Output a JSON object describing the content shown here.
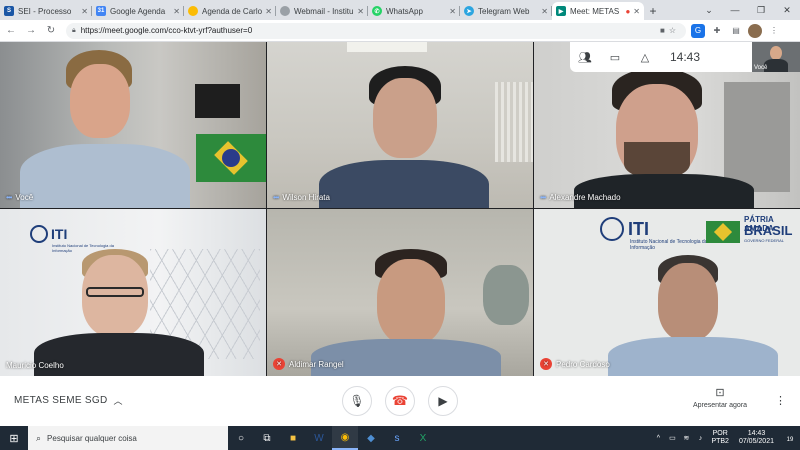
{
  "browser": {
    "tabs": [
      {
        "title": "SEI - Processo",
        "favicon": "SEI",
        "color": "#1a56a5",
        "active": false
      },
      {
        "title": "Google Agenda",
        "favicon": "31",
        "color": "#4285f4",
        "active": false
      },
      {
        "title": "Agenda de Carlo",
        "favicon": "●",
        "color": "#fbbc05",
        "active": false
      },
      {
        "title": "Webmail - Institu",
        "favicon": "●",
        "color": "#9aa0a6",
        "active": false
      },
      {
        "title": "WhatsApp",
        "favicon": "✆",
        "color": "#25d366",
        "active": false
      },
      {
        "title": "Telegram Web",
        "favicon": "➤",
        "color": "#2ca5e0",
        "active": false
      },
      {
        "title": "Meet: METAS",
        "favicon": "▶",
        "color": "#00897b",
        "active": true
      }
    ],
    "new_tab": "+",
    "url": "https://meet.google.com/cco-ktvt-yrf?authuser=0"
  },
  "meet": {
    "clock": "14:43",
    "self_label": "Você",
    "participants": [
      {
        "name": "Você",
        "muted": false,
        "speaking": true
      },
      {
        "name": "Wilson Hirata",
        "muted": false,
        "speaking": true
      },
      {
        "name": "Alexandre Machado",
        "muted": false,
        "speaking": true
      },
      {
        "name": "Mauricio Coelho",
        "muted": false,
        "speaking": false
      },
      {
        "name": "Aldimar Rangel",
        "muted": true,
        "speaking": false
      },
      {
        "name": "Pedro Cardoso",
        "muted": true,
        "speaking": false
      }
    ],
    "tile_texts": {
      "iti_logo": "ITI",
      "iti_sub": "Instituto Nacional de Tecnologia da Informação",
      "patria": "PÁTRIA AMADA",
      "brasil": "BRASIL",
      "gov": "GOVERNO FEDERAL"
    },
    "meeting_name": "METAS SEME SGD",
    "present_label": "Apresentar agora"
  },
  "taskbar": {
    "search_placeholder": "Pesquisar qualquer coisa",
    "lang1": "POR",
    "lang2": "PTB2",
    "time": "14:43",
    "date": "07/05/2021",
    "notif_count": "19"
  },
  "colors": {
    "accent": "#8ab4f8",
    "hangup": "#ea4335",
    "taskbar": "#1f2a36"
  }
}
